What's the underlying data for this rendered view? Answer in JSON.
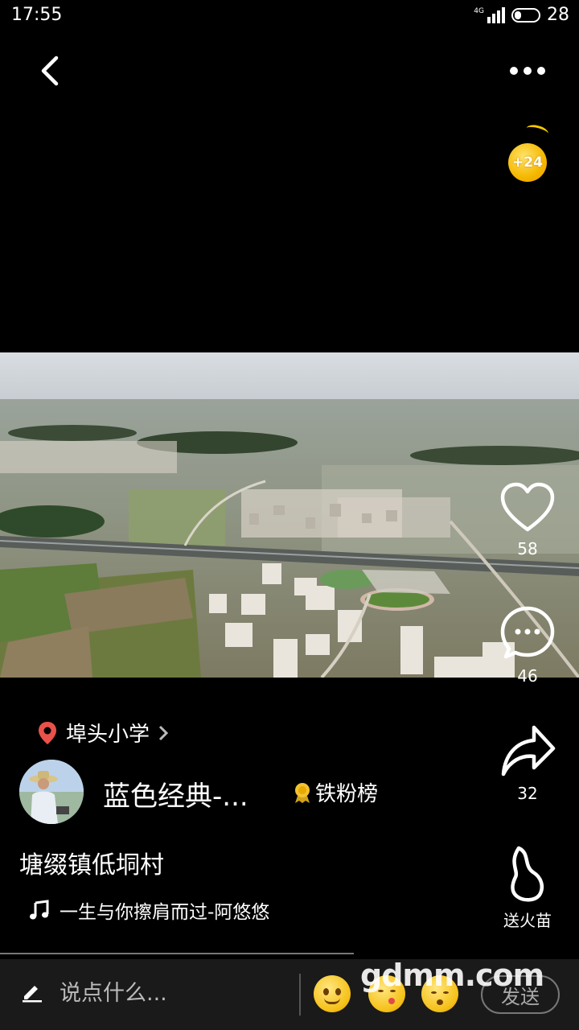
{
  "status_bar": {
    "time": "17:55",
    "network": "4G",
    "battery": "28"
  },
  "top_bar": {
    "back_icon": "back-chevron-icon",
    "more_icon": "more-dots-icon"
  },
  "coin": {
    "label": "+24"
  },
  "actions": {
    "like_count": "58",
    "comment_count": "46",
    "share_count": "32",
    "fire_label": "送火苗"
  },
  "post": {
    "location": "埠头小学",
    "author": "蓝色经典-...",
    "fans_board": "铁粉榜",
    "description": "塘缀镇低垌村",
    "music": "一生与你擦肩而过-阿悠悠"
  },
  "bottom_bar": {
    "placeholder": "说点什么...",
    "send_label": "发送"
  },
  "watermark": "gdmm.com",
  "colors": {
    "location_pin": "#e8524a",
    "coin": "#f5b800",
    "background": "#000000"
  }
}
